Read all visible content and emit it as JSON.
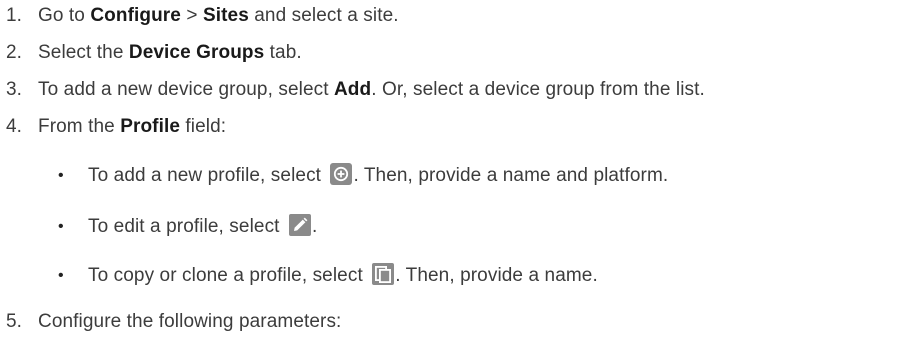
{
  "steps": [
    {
      "number": "1.",
      "parts": {
        "a": "Go to ",
        "b": "Configure",
        "c": " > ",
        "d": "Sites",
        "e": " and select a site."
      }
    },
    {
      "number": "2.",
      "parts": {
        "a": "Select the ",
        "b": "Device Groups",
        "c": " tab."
      }
    },
    {
      "number": "3.",
      "parts": {
        "a": "To add a new device group, select ",
        "b": "Add",
        "c": ". Or, select a device group from the list."
      }
    },
    {
      "number": "4.",
      "parts": {
        "a": "From the ",
        "b": "Profile",
        "c": " field:"
      },
      "substeps": [
        {
          "bullet": "•",
          "before": "To add a new profile, select ",
          "icon": "add-circle-icon",
          "after": ". Then, provide a name and platform."
        },
        {
          "bullet": "•",
          "before": "To edit a profile, select ",
          "icon": "pencil-edit-icon",
          "after": "."
        },
        {
          "bullet": "•",
          "before": "To copy or clone a profile, select ",
          "icon": "copy-clone-icon",
          "after": ". Then, provide a name."
        }
      ]
    },
    {
      "number": "5.",
      "parts": {
        "a": "Configure the following parameters:"
      }
    }
  ],
  "colors": {
    "text": "#3c3c3c",
    "bold": "#1a1a1a",
    "icon_bg": "#8a8a8a",
    "icon_fg": "#ffffff"
  }
}
